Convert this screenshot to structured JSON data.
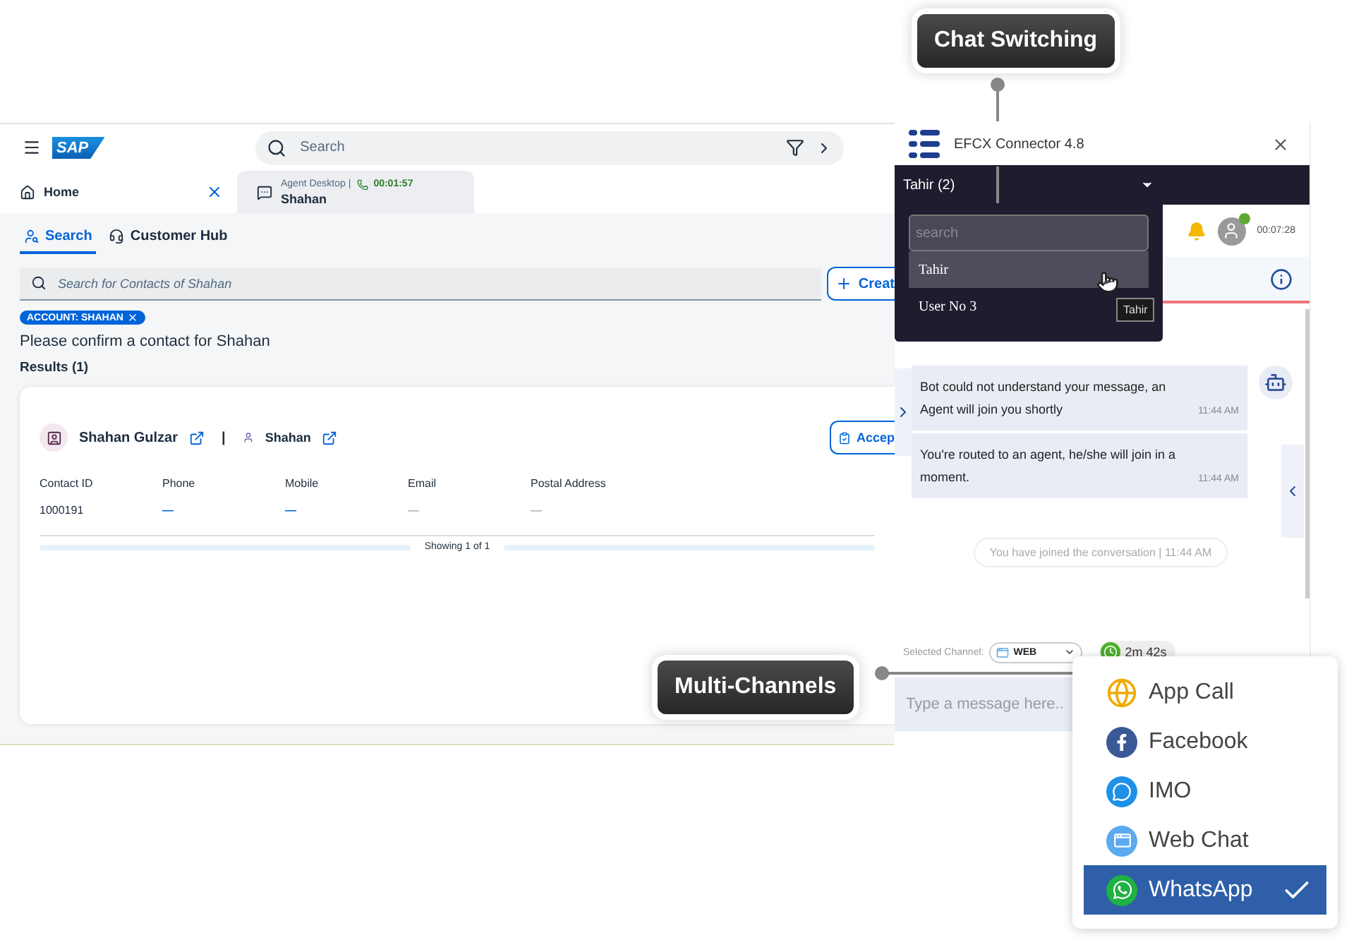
{
  "callouts": [
    {
      "label": "Chat Switching"
    },
    {
      "label": "Multi-Channels"
    }
  ],
  "sap": {
    "logo": "SAP",
    "search_placeholder": "Search",
    "tabs": [
      {
        "kind": "home",
        "label": "Home",
        "selected": false
      },
      {
        "kind": "agent",
        "title": "Agent Desktop |",
        "timer": "00:01:57",
        "label": "Shahan",
        "selected": true
      }
    ],
    "view_tabs": [
      {
        "kind": "search",
        "label": "Search",
        "selected": true
      },
      {
        "kind": "hub",
        "label": "Customer Hub",
        "selected": false
      }
    ],
    "contact_search": {
      "placeholder": "Search for Contacts of Shahan"
    },
    "create_button": "Creat",
    "token": "ACCOUNT: SHAHAN",
    "prompt": "Please confirm a contact for Shahan",
    "results_title": "Results (1)",
    "result": {
      "name": "Shahan Gulzar",
      "separator": "|",
      "account": "Shahan",
      "accept_button": "Accep",
      "columns": [
        "Contact ID",
        "Phone",
        "Mobile",
        "Email",
        "Postal Address"
      ],
      "cells": [
        {
          "kind": "text",
          "text": "1000191"
        },
        {
          "kind": "link",
          "text": "—"
        },
        {
          "kind": "link",
          "text": "—"
        },
        {
          "kind": "muted",
          "text": "—"
        },
        {
          "kind": "muted",
          "text": "—"
        }
      ],
      "footer": "Showing 1 of 1"
    }
  },
  "connector": {
    "title": "EFCX Connector 4.8",
    "chat_selector": "Tahir (2)",
    "session_time": "00:07:28",
    "agent_online": true,
    "messages": [
      {
        "text": "Bot could not understand your message, an Agent will join you shortly",
        "time": "11:44 AM"
      },
      {
        "text": "You're routed to an agent, he/she will join in a moment.",
        "time": "11:44 AM"
      }
    ],
    "system_note": "You have joined the conversation | 11:44 AM",
    "channel_label": "Selected Channel:",
    "channel": "WEB",
    "wait_time": "2m 42s",
    "composer_placeholder": "Type a message here.."
  },
  "chat_menu": {
    "search_placeholder": "search",
    "items": [
      {
        "label": "Tahir",
        "selected": true
      },
      {
        "label": "User No 3",
        "selected": false
      }
    ],
    "tooltip": "Tahir"
  },
  "channel_menu": [
    {
      "kind": "app_call",
      "label": "App Call",
      "selected": false
    },
    {
      "kind": "facebook",
      "label": "Facebook",
      "selected": false
    },
    {
      "kind": "imo",
      "label": "IMO",
      "selected": false
    },
    {
      "kind": "web_chat",
      "label": "Web Chat",
      "selected": false
    },
    {
      "kind": "whatsapp",
      "label": "WhatsApp",
      "selected": true
    }
  ]
}
